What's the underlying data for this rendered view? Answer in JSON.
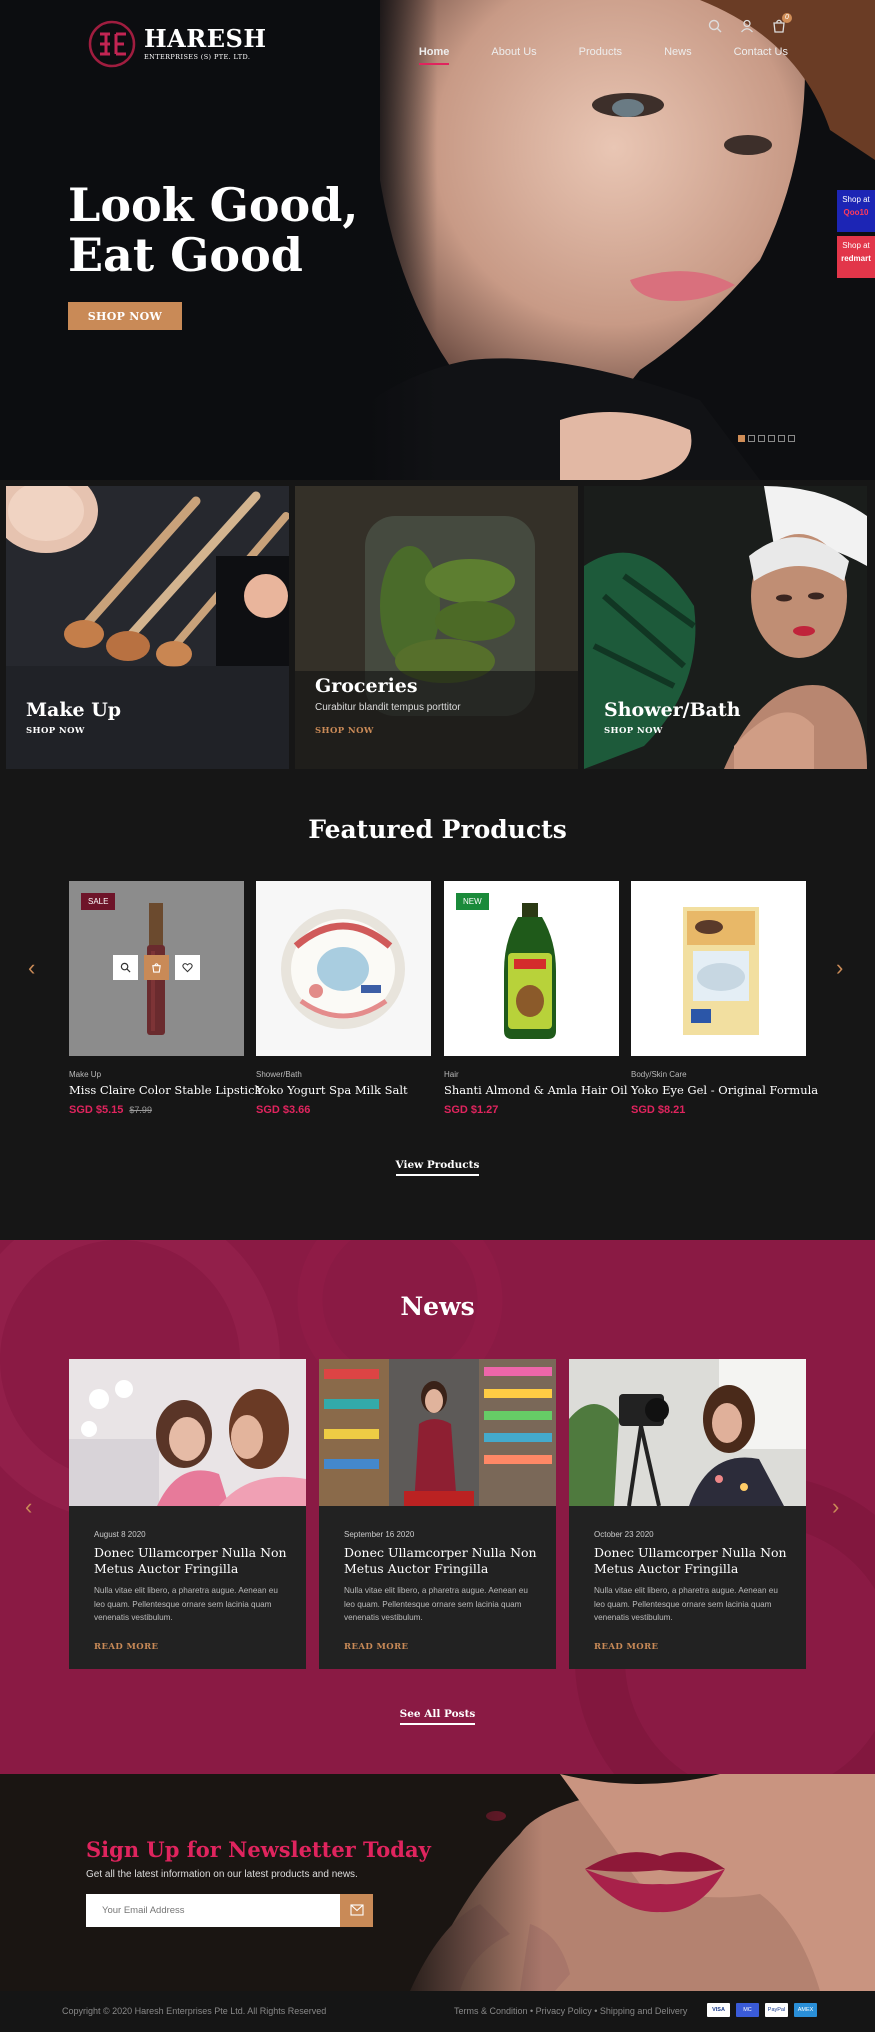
{
  "brand": {
    "name": "HARESH",
    "sub": "ENTERPRISES (S) PTE. LTD."
  },
  "nav": [
    {
      "label": "Home"
    },
    {
      "label": "About Us"
    },
    {
      "label": "Products"
    },
    {
      "label": "News"
    },
    {
      "label": "Contact Us"
    }
  ],
  "cart": {
    "count": "0"
  },
  "hero": {
    "title_line1": "Look Good,",
    "title_line2": "Eat Good",
    "button": "SHOP NOW",
    "slide_index": 1,
    "slide_count": 6
  },
  "side_badges": [
    {
      "label": "Shop at",
      "brand": "Qoo10"
    },
    {
      "label": "Shop at",
      "brand": "redmart"
    }
  ],
  "categories": [
    {
      "title": "Make Up",
      "subtitle": "",
      "link": "SHOP NOW"
    },
    {
      "title": "Groceries",
      "subtitle": "Curabitur blandit tempus porttitor",
      "link": "SHOP NOW"
    },
    {
      "title": "Shower/Bath",
      "subtitle": "",
      "link": "SHOP NOW"
    }
  ],
  "featured": {
    "title": "Featured Products",
    "view_link": "View Products",
    "products": [
      {
        "category": "Make Up",
        "name": "Miss Claire Color Stable Lipstick",
        "price": "SGD $5.15",
        "old_price": "$7.99",
        "tag": "SALE"
      },
      {
        "category": "Shower/Bath",
        "name": "Yoko Yogurt Spa Milk Salt",
        "price": "SGD $3.66",
        "old_price": "",
        "tag": ""
      },
      {
        "category": "Hair",
        "name": "Shanti Almond & Amla Hair Oil",
        "price": "SGD $1.27",
        "old_price": "",
        "tag": "NEW"
      },
      {
        "category": "Body/Skin Care",
        "name": "Yoko Eye Gel - Original Formula",
        "price": "SGD $8.21",
        "old_price": "",
        "tag": ""
      }
    ]
  },
  "news": {
    "title": "News",
    "all_link": "See All Posts",
    "posts": [
      {
        "date": "August 8 2020",
        "title": "Donec Ullamcorper Nulla Non Metus Auctor Fringilla",
        "body": "Nulla vitae elit libero, a pharetra augue. Aenean eu leo quam. Pellentesque ornare sem lacinia quam venenatis vestibulum.",
        "more": "READ MORE"
      },
      {
        "date": "September 16 2020",
        "title": "Donec Ullamcorper Nulla Non Metus Auctor Fringilla",
        "body": "Nulla vitae elit libero, a pharetra augue. Aenean eu leo quam. Pellentesque ornare sem lacinia quam venenatis vestibulum.",
        "more": "READ MORE"
      },
      {
        "date": "October 23 2020",
        "title": "Donec Ullamcorper Nulla Non Metus Auctor Fringilla",
        "body": "Nulla vitae elit libero, a pharetra augue. Aenean eu leo quam. Pellentesque ornare sem lacinia quam venenatis vestibulum.",
        "more": "READ MORE"
      }
    ]
  },
  "newsletter": {
    "title": "Sign Up for Newsletter Today",
    "subtitle": "Get all the latest information on our latest products and news.",
    "placeholder": "Your Email Address"
  },
  "footer": {
    "copyright": "Copyright © 2020 Haresh Enterprises Pte Ltd. All Rights Reserved",
    "links": "Terms & Condition • Privacy Policy • Shipping and Delivery",
    "cards": [
      "VISA",
      "MC",
      "PayPal",
      "AMEX"
    ]
  },
  "colors": {
    "accent": "#e0245e",
    "gold": "#c98a57",
    "news_bg": "#8a1a44"
  }
}
